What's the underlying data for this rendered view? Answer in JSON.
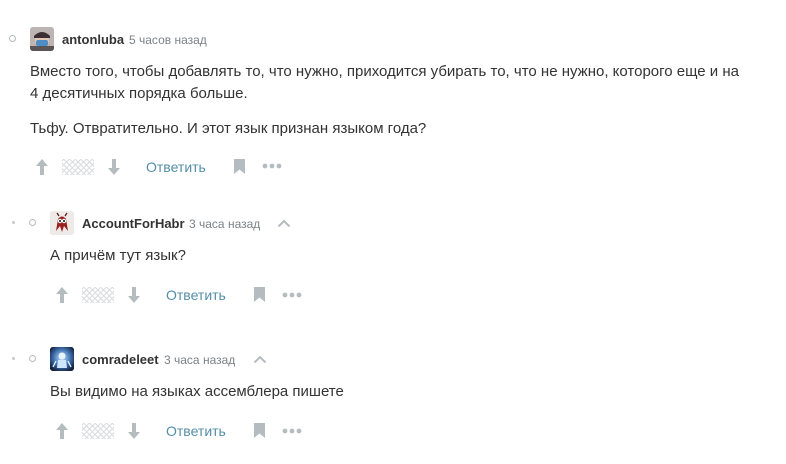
{
  "comments": [
    {
      "username": "antonluba",
      "time": "5 часов назад",
      "paragraphs": [
        "Вместо того, чтобы добавлять то, что нужно, приходится убирать то, что не нужно, которого еще и на 4 десятичных порядка больше.",
        "Тьфу. Отвратительно. И этот язык признан языком года?"
      ],
      "reply_label": "Ответить",
      "avatar_icon": "avatar-masked-person"
    },
    {
      "username": "AccountForHabr",
      "time": "3 часа назад",
      "paragraphs": [
        "А причём тут язык?"
      ],
      "reply_label": "Ответить",
      "avatar_icon": "avatar-red-creature"
    },
    {
      "username": "comradeleet",
      "time": "3 часа назад",
      "paragraphs": [
        "Вы видимо на языках ассемблера пишете"
      ],
      "reply_label": "Ответить",
      "avatar_icon": "avatar-robot"
    }
  ],
  "icons": {
    "upvote": "arrow-up-icon",
    "downvote": "arrow-down-icon",
    "bookmark": "bookmark-icon",
    "more": "more-dots-icon",
    "parent": "chevron-up-icon"
  },
  "colors": {
    "link": "#548eaa",
    "icon": "#b5bcc0",
    "text": "#333333",
    "meta": "#7b8287"
  }
}
